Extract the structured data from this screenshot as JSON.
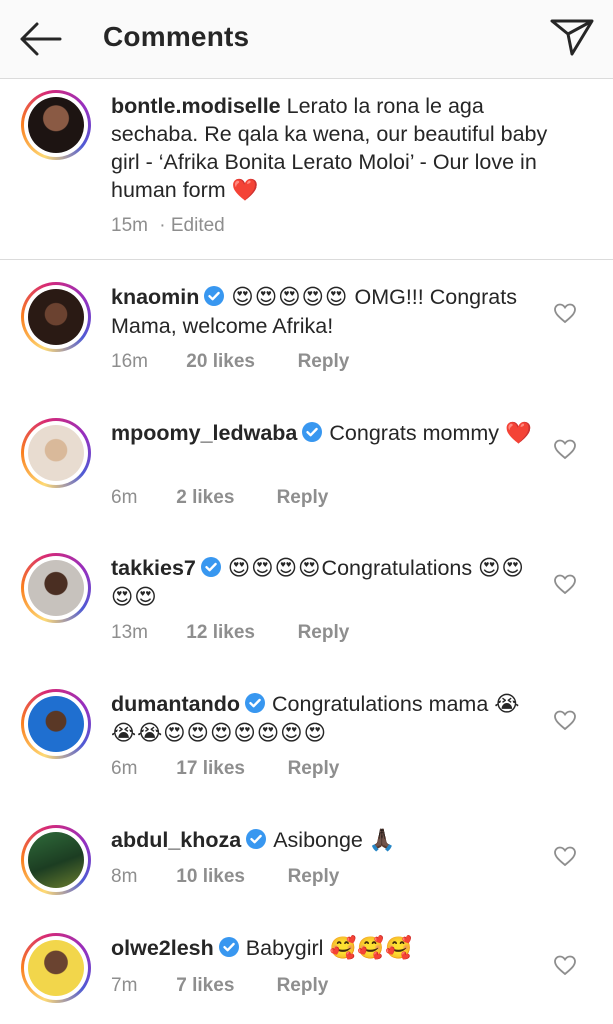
{
  "header": {
    "title": "Comments"
  },
  "caption": {
    "username": "bontle.modiselle",
    "text": "Lerato la rona le aga sechaba. Re qala ka wena, our beautiful baby girl - ‘Afrika Bonita Lerato Moloi’ - Our love in human form",
    "emoji": "❤️",
    "time": "15m",
    "edited": "· Edited"
  },
  "comments": [
    {
      "username": "knaomin",
      "emoji": "😍😍😍😍😍",
      "text": "OMG!!! Congrats Mama, welcome Afrika!",
      "time": "16m",
      "likes": "20 likes",
      "reply": "Reply"
    },
    {
      "username": "mpoomy_ledwaba",
      "emoji": "",
      "text": "Congrats mommy",
      "emoji_after": "❤️",
      "time": "6m",
      "likes": "2 likes",
      "reply": "Reply"
    },
    {
      "username": "takkies7",
      "emoji": "😍😍😍😍",
      "text": "Congratulations",
      "emoji_after": "😍😍😍😍",
      "time": "13m",
      "likes": "12 likes",
      "reply": "Reply"
    },
    {
      "username": "dumantando",
      "emoji": "",
      "text": "Congratulations mama",
      "emoji_after": "😭😭😭😍😍😍😍😍😍😍",
      "time": "6m",
      "likes": "17 likes",
      "reply": "Reply"
    },
    {
      "username": "abdul_khoza",
      "emoji": "",
      "text": "Asibonge",
      "emoji_after": "🙏🏿",
      "time": "8m",
      "likes": "10 likes",
      "reply": "Reply"
    },
    {
      "username": "olwe2lesh",
      "emoji": "",
      "text": "Babygirl",
      "emoji_after": "🥰🥰🥰",
      "time": "7m",
      "likes": "7 likes",
      "reply": "Reply"
    }
  ],
  "colors": {
    "text": "#262626",
    "meta": "#8e8e8e",
    "verified": "#3897f0",
    "heart_red": "#e0201f",
    "divider": "#dbdbdb"
  }
}
